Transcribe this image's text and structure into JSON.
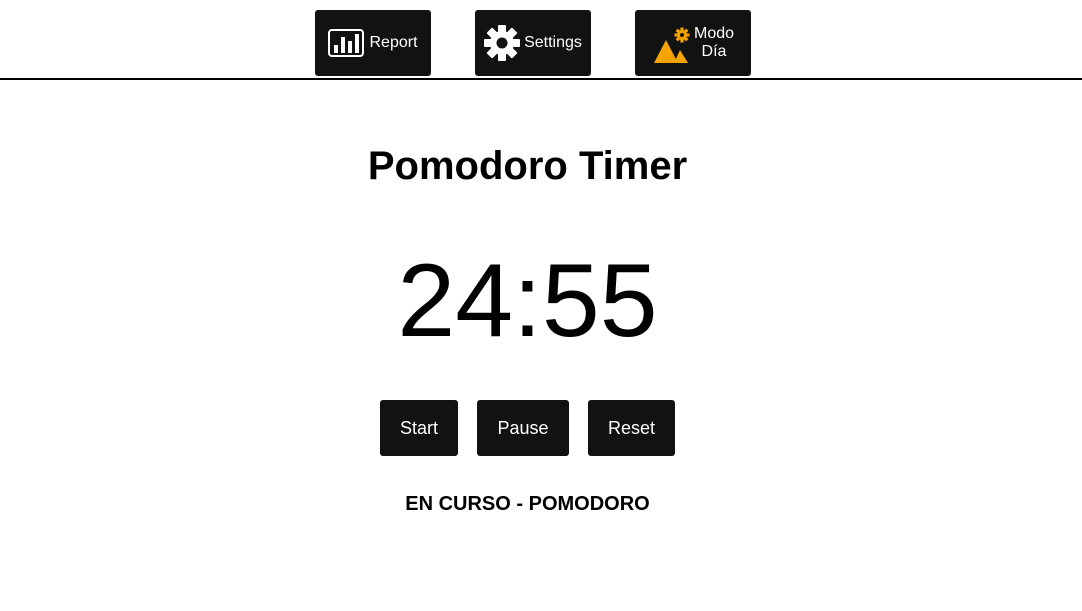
{
  "nav": {
    "report_label": "Report",
    "settings_label": "Settings",
    "mode_label_line1": "Modo",
    "mode_label_line2": "Día"
  },
  "main": {
    "title": "Pomodoro Timer",
    "timer": "24:55",
    "status": "EN CURSO - POMODORO"
  },
  "controls": {
    "start_label": "Start",
    "pause_label": "Pause",
    "reset_label": "Reset"
  },
  "icons": {
    "report": "bar-chart-icon",
    "settings": "gear-icon",
    "mode": "day-mode-icon"
  },
  "colors": {
    "button_bg": "#121212",
    "button_text": "#ffffff",
    "accent_mode": "#f5a300",
    "divider": "#000000"
  }
}
